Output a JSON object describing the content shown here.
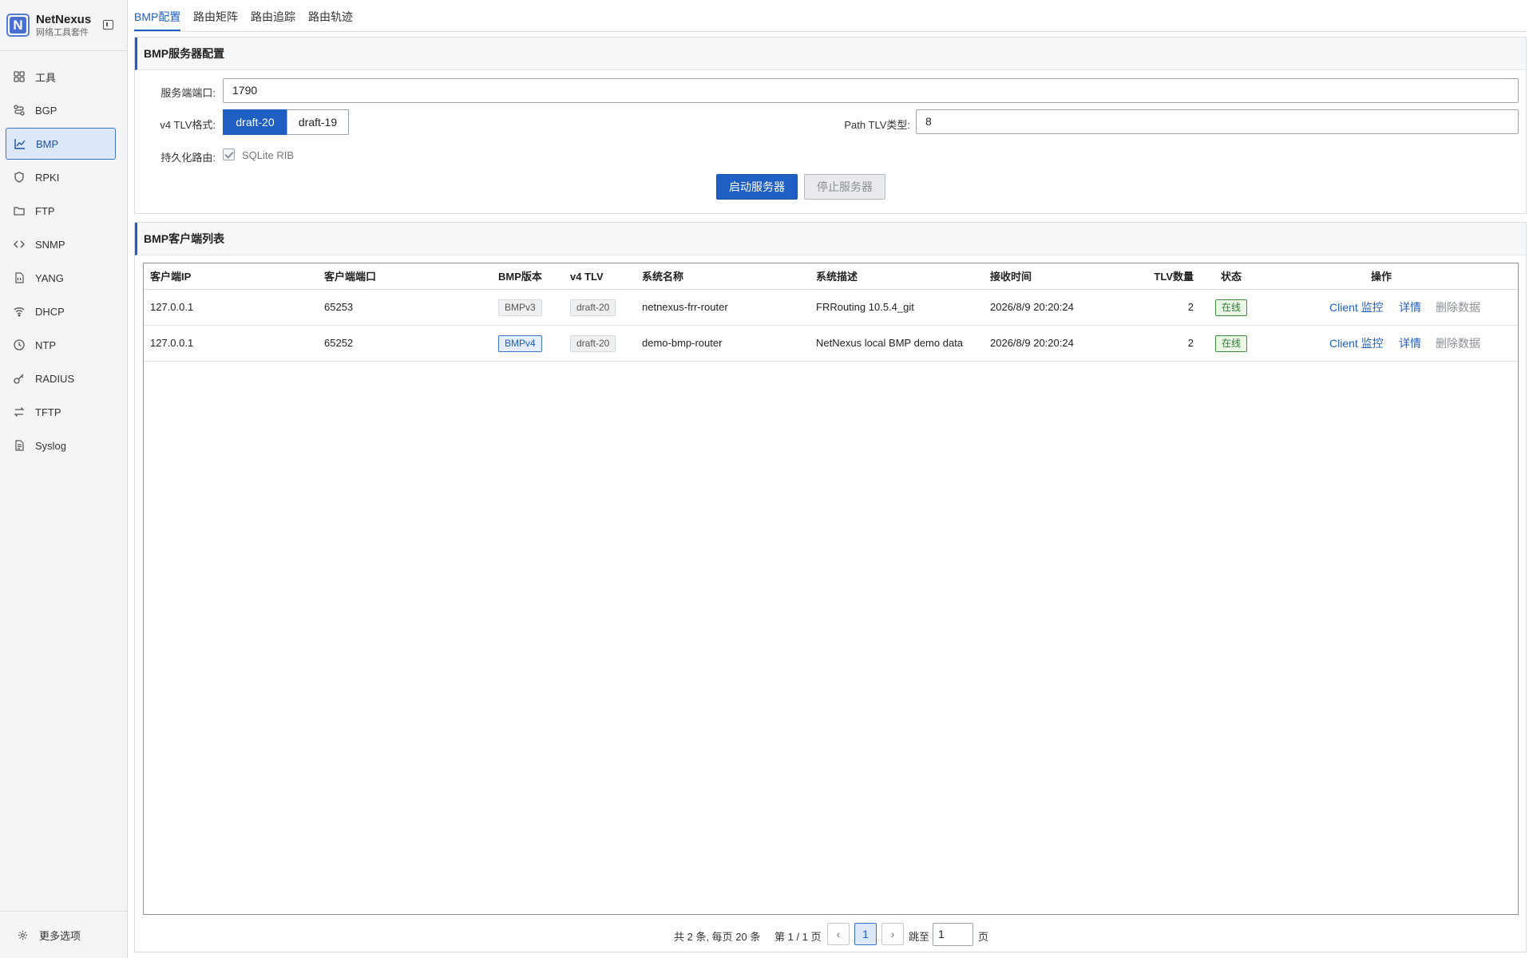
{
  "app": {
    "name": "NetNexus",
    "subtitle": "网络工具套件",
    "logo_letter": "N"
  },
  "sidebar": {
    "items": [
      {
        "label": "工具",
        "icon": "grid-icon"
      },
      {
        "label": "BGP",
        "icon": "route-icon"
      },
      {
        "label": "BMP",
        "icon": "chart-icon",
        "active": true
      },
      {
        "label": "RPKI",
        "icon": "shield-icon"
      },
      {
        "label": "FTP",
        "icon": "folder-icon"
      },
      {
        "label": "SNMP",
        "icon": "code-icon"
      },
      {
        "label": "YANG",
        "icon": "file-code-icon"
      },
      {
        "label": "DHCP",
        "icon": "wifi-icon"
      },
      {
        "label": "NTP",
        "icon": "clock-icon"
      },
      {
        "label": "RADIUS",
        "icon": "key-icon"
      },
      {
        "label": "TFTP",
        "icon": "swap-icon"
      },
      {
        "label": "Syslog",
        "icon": "document-icon"
      }
    ],
    "more_options": "更多选项"
  },
  "tabs": [
    {
      "label": "BMP配置",
      "active": true
    },
    {
      "label": "路由矩阵"
    },
    {
      "label": "路由追踪"
    },
    {
      "label": "路由轨迹"
    }
  ],
  "server_config": {
    "title": "BMP服务器配置",
    "port_label": "服务端端口:",
    "port_value": "1790",
    "tlv_label": "v4 TLV格式:",
    "tlv_options": [
      "draft-20",
      "draft-19"
    ],
    "tlv_selected": "draft-20",
    "path_tlv_label": "Path TLV类型:",
    "path_tlv_value": "8",
    "persist_label": "持久化路由:",
    "persist_option": "SQLite RIB",
    "persist_checked": true,
    "start_button": "启动服务器",
    "stop_button": "停止服务器"
  },
  "clients": {
    "title": "BMP客户端列表",
    "columns": [
      "客户端IP",
      "客户端端口",
      "BMP版本",
      "v4 TLV",
      "系统名称",
      "系统描述",
      "接收时间",
      "TLV数量",
      "状态",
      "操作"
    ],
    "rows": [
      {
        "ip": "127.0.0.1",
        "port": "65253",
        "version": "BMPv3",
        "tlv": "draft-20",
        "sys_name": "netnexus-frr-router",
        "sys_desc": "FRRouting 10.5.4_git",
        "time": "2026/8/9 20:20:24",
        "tlv_count": "2",
        "status": "在线"
      },
      {
        "ip": "127.0.0.1",
        "port": "65252",
        "version": "BMPv4",
        "tlv": "draft-20",
        "sys_name": "demo-bmp-router",
        "sys_desc": "NetNexus local BMP demo data",
        "time": "2026/8/9 20:20:24",
        "tlv_count": "2",
        "status": "在线"
      }
    ],
    "actions": {
      "monitor": "Client 监控",
      "detail": "详情",
      "delete": "删除数据"
    }
  },
  "pagination": {
    "summary": "共 2 条, 每页 20 条",
    "page_info": "第 1 / 1 页",
    "prev": "‹",
    "current": "1",
    "next": "›",
    "jump_label": "跳至",
    "jump_value": "1",
    "page_suffix": "页"
  },
  "colors": {
    "accent": "#1f5fc4",
    "online": "#2e7d32"
  }
}
